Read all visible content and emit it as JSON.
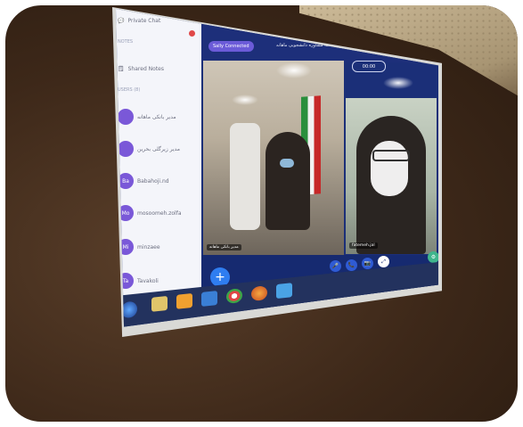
{
  "sidebar": {
    "items": [
      {
        "label": "Private Chat",
        "icon": "chat-icon"
      },
      {
        "label": "Shared Notes",
        "icon": "notes-icon"
      }
    ],
    "sections": [
      "NOTES",
      "USERS (8)"
    ],
    "users": [
      {
        "initials": "",
        "name": "مدیر بانکی ماهانه"
      },
      {
        "initials": "",
        "name": "مدیر زیرگلی بحرین"
      },
      {
        "initials": "Ba",
        "name": "Babahoji.nd"
      },
      {
        "initials": "Mo",
        "name": "mosoomeh.zolfa"
      },
      {
        "initials": "Mi",
        "name": "minzaee"
      },
      {
        "initials": "Ta",
        "name": "Tavakoli"
      }
    ],
    "chat_badge": "3"
  },
  "meeting": {
    "status_pill": "Sally Connected",
    "topic": "جلسه مشاوره دانشجویی ماهانه",
    "recording_label": "00:00",
    "left_name_tag": "مدیر بانکی ماهانه",
    "right_name_tag": "fatemeh.jal"
  },
  "colors": {
    "screen_bg": "#1b2f78",
    "accent": "#2f7df0",
    "avatar": "#7a58d8",
    "badge": "#e04848"
  }
}
